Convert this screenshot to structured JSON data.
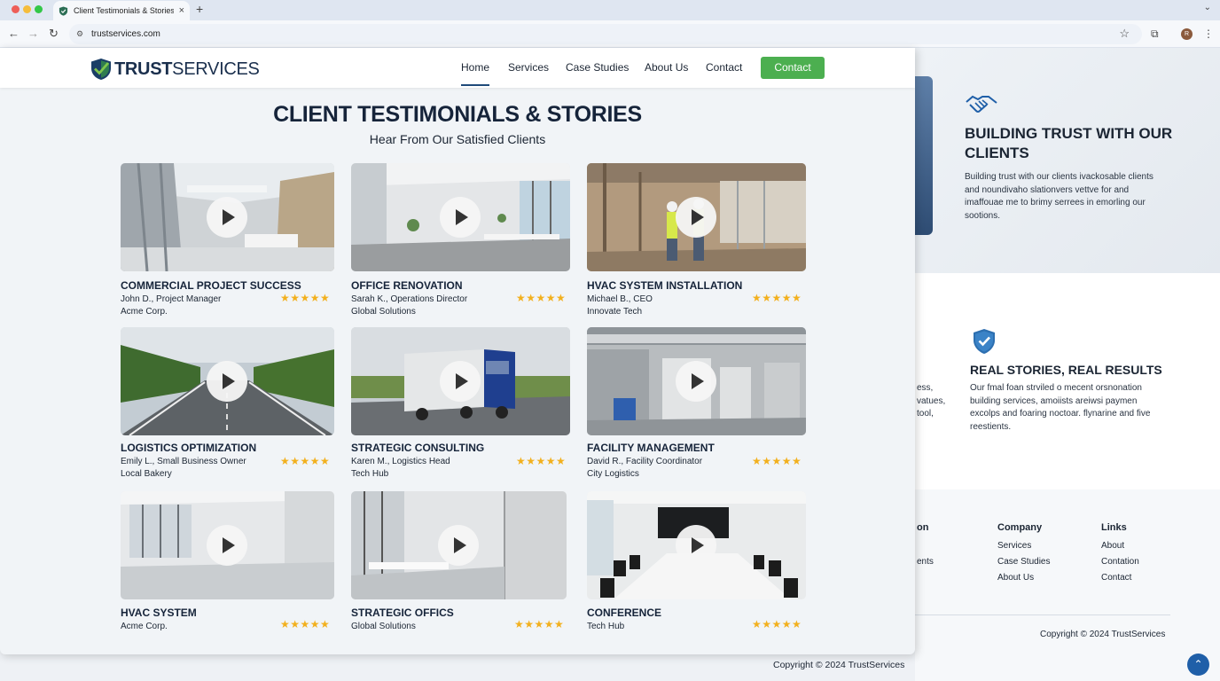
{
  "browser": {
    "tab_title": "Client Testimonials & Stories",
    "url": "trustservices.com",
    "avatar_letter": "R"
  },
  "brand": {
    "logo_bold": "TRUST",
    "logo_regular": "SERVICES"
  },
  "nav": {
    "items": [
      "Home",
      "Services",
      "Case Studies",
      "About Us",
      "Contact"
    ],
    "contact_button": "Contact"
  },
  "hero": {
    "title": "CLIENT TESTIMONIALS & STORIES",
    "subtitle": "Hear From Our Satisfied Clients"
  },
  "testimonials": [
    {
      "title": "COMMERCIAL PROJECT SUCCESS",
      "person": "John D., Project Manager",
      "company": "Acme Corp.",
      "rating": 5
    },
    {
      "title": "OFFICE RENOVATION",
      "person": "Sarah K., Operations Director",
      "company": "Global Solutions",
      "rating": 5
    },
    {
      "title": "HVAC SYSTEM INSTALLATION",
      "person": "Michael B., CEO",
      "company": "Innovate Tech",
      "rating": 5
    },
    {
      "title": "LOGISTICS OPTIMIZATION",
      "person": "Emily L., Small Business Owner",
      "company": "Local Bakery",
      "rating": 5
    },
    {
      "title": "STRATEGIC CONSULTING",
      "person": "Karen M., Logistics Head",
      "company": "Tech Hub",
      "rating": 5
    },
    {
      "title": "FACILITY MANAGEMENT",
      "person": "David R., Facility Coordinator",
      "company": "City Logistics",
      "rating": 5
    },
    {
      "title": "HVAC SYSTEM",
      "person": "Acme Corp.",
      "company": "",
      "rating": 5
    },
    {
      "title": "STRATEGIC OFFICS",
      "person": "Global Solutions",
      "company": "",
      "rating": 5
    },
    {
      "title": "CONFERENCE",
      "person": "Tech Hub",
      "company": "",
      "rating": 5
    }
  ],
  "stars_text": "★★★★★",
  "background_page": {
    "trust_heading": "BUILDING TRUST WITH OUR CLIENTS",
    "trust_text": "Building trust with our clients ivackosable clients and noundivaho slationvers vettve for and imaffouae me to brimy serrees in emorling our sootions.",
    "stories_heading": "REAL STORIES, REAL RESULTS",
    "stories_text": "Our fmal foan strviled o mecent orsnonation building services, amoiists areiwsi paymen excolps and foaring noctoar. flynarine and five reestients.",
    "fragments": [
      "ess,",
      "vatues,",
      "tool,"
    ],
    "footer_frag_head": "on",
    "footer_frag_link": "ents",
    "company_heading": "Company",
    "company_links": [
      "Services",
      "Case Studies",
      "About Us"
    ],
    "links_heading": "Links",
    "links_links": [
      "About",
      "Contation",
      "Contact"
    ],
    "copyright_right": "Copyright © 2024 TrustServices",
    "copyright_bottom": "Copyright © 2024 TrustServices"
  },
  "colors": {
    "accent": "#4caf50",
    "brand_navy": "#1a2f4d",
    "star": "#f2b01e"
  }
}
